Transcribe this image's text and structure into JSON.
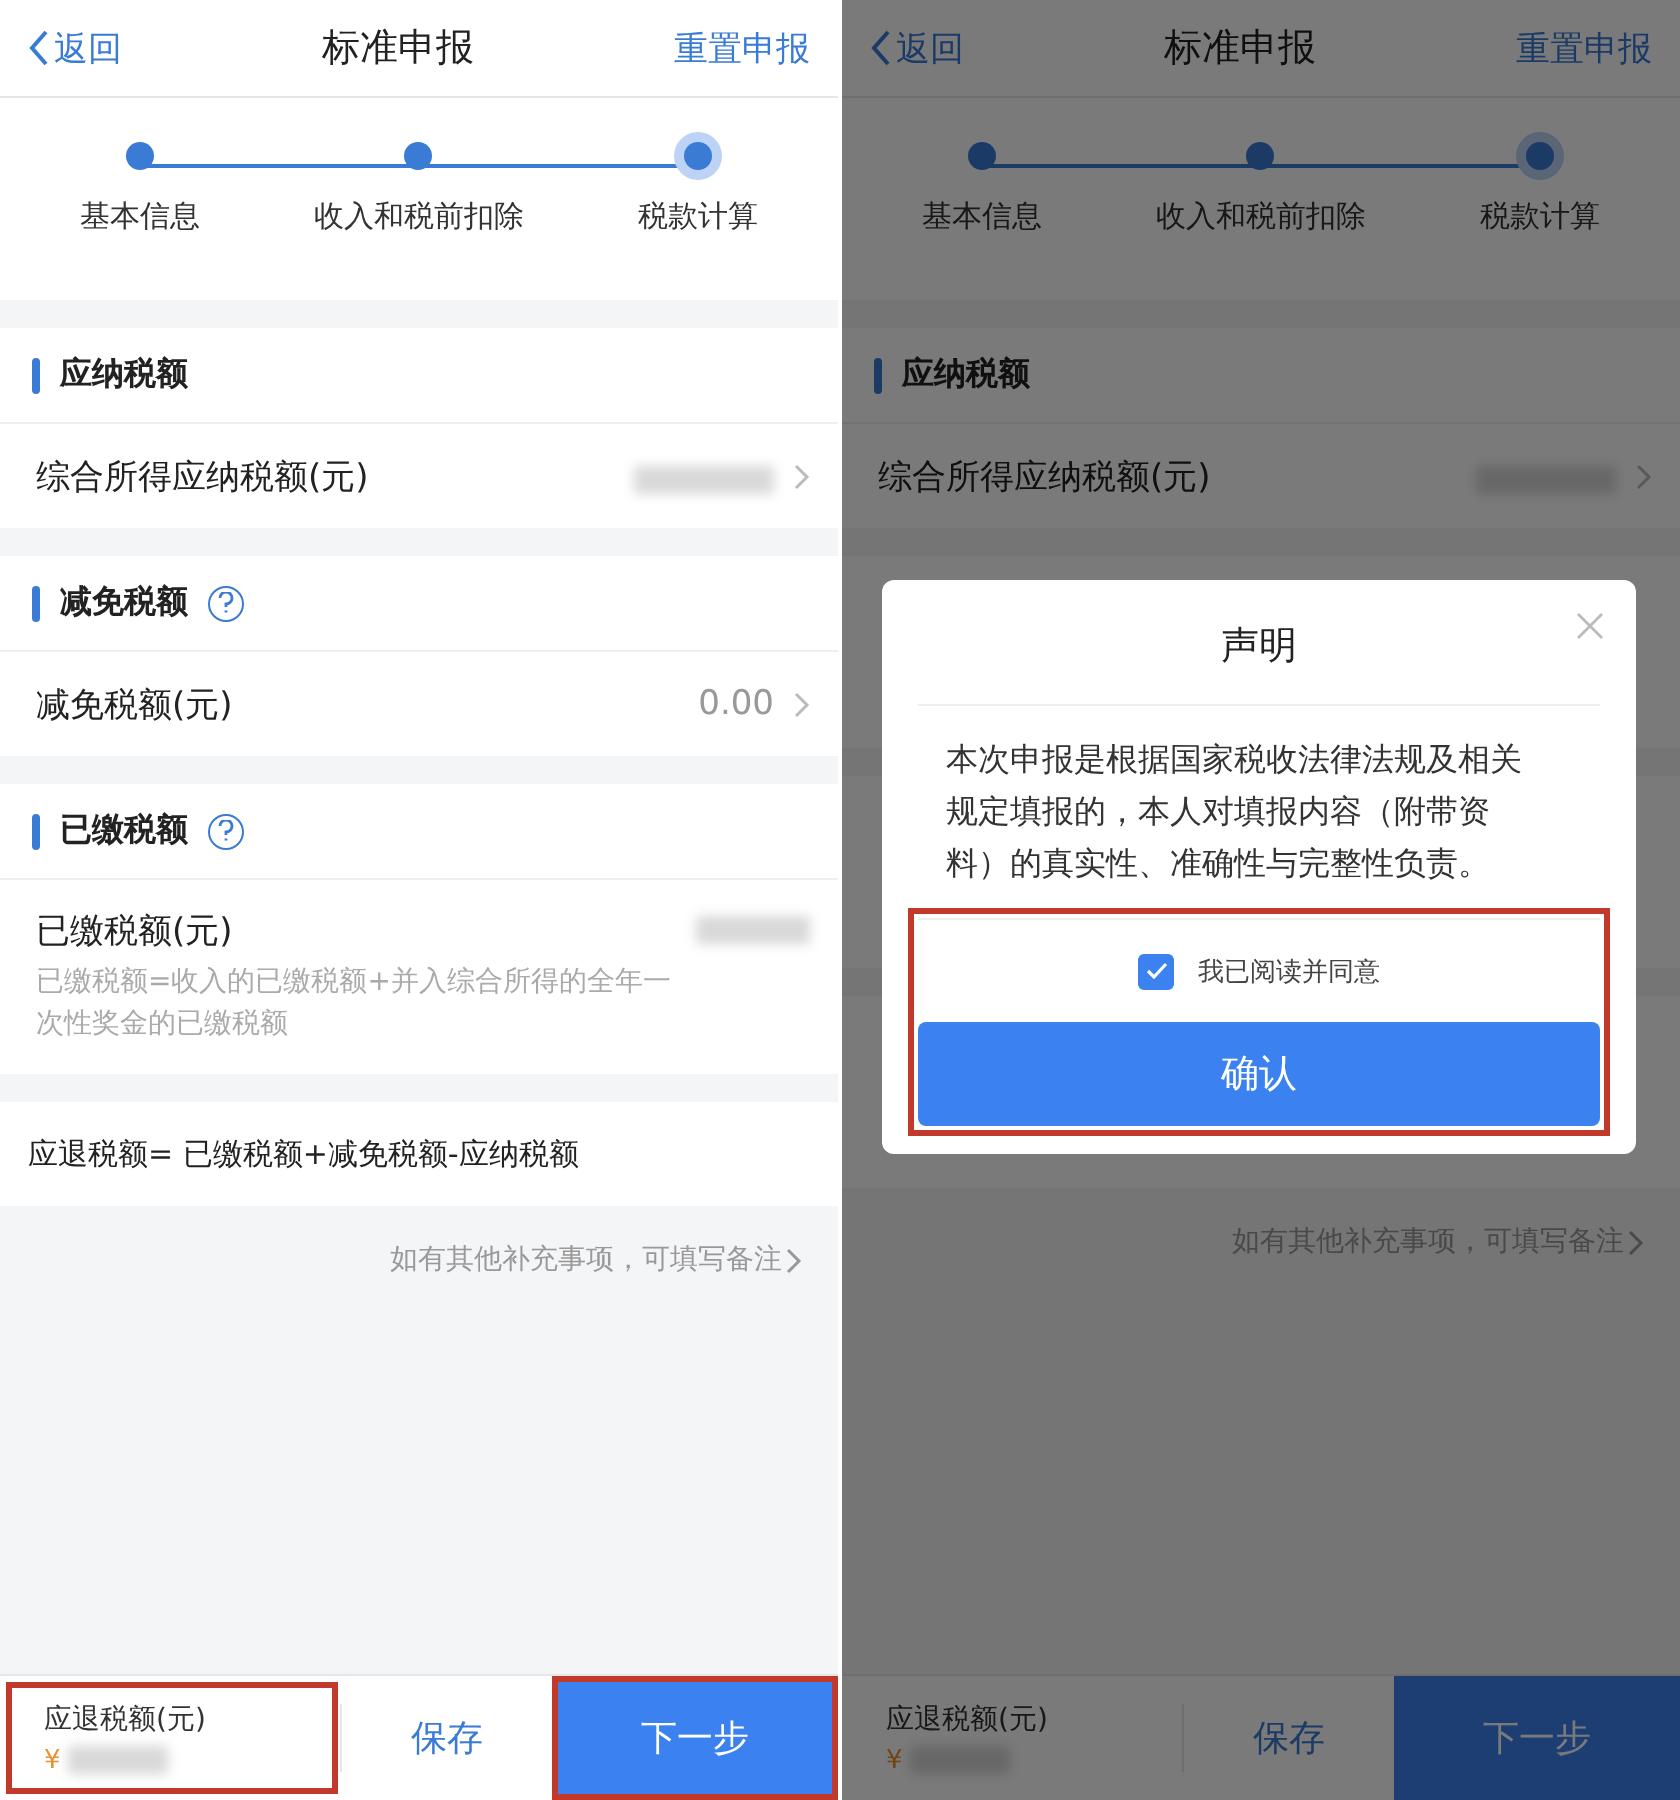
{
  "screens": [
    {
      "nav": {
        "back": "返回",
        "title": "标准申报",
        "action": "重置申报"
      },
      "steps": [
        {
          "label": "基本信息",
          "current": false
        },
        {
          "label": "收入和税前扣除",
          "current": false
        },
        {
          "label": "税款计算",
          "current": true
        }
      ],
      "sections": [
        {
          "title": "应纳税额",
          "help": false,
          "rows": [
            {
              "label": "综合所得应纳税额(元)",
              "value_blurred": true
            }
          ]
        },
        {
          "title": "减免税额",
          "help": true,
          "rows": [
            {
              "label": "减免税额(元)",
              "value": "0.00"
            }
          ]
        },
        {
          "title": "已缴税额",
          "help": true,
          "rows": [
            {
              "label": "已缴税额(元)",
              "note": "已缴税额=收入的已缴税额+并入综合所得的全年一次性奖金的已缴税额",
              "value_blurred": true
            }
          ]
        }
      ],
      "formula": "应退税额= 已缴税额+减免税额-应纳税额",
      "remark_link": "如有其他补充事项，可填写备注",
      "bottom": {
        "total_label": "应退税额(元)",
        "currency": "¥",
        "total_annotated": true,
        "save": "保存",
        "next": "下一步",
        "next_annotated": true
      }
    },
    {
      "nav": {
        "back": "返回",
        "title": "标准申报",
        "action": "重置申报"
      },
      "steps": [
        {
          "label": "基本信息",
          "current": false
        },
        {
          "label": "收入和税前扣除",
          "current": false
        },
        {
          "label": "税款计算",
          "current": true
        }
      ],
      "sections": [
        {
          "title": "应纳税额",
          "help": false,
          "rows": [
            {
              "label": "综合所得应纳税额(元)",
              "value_blurred": true
            }
          ]
        }
      ],
      "remark_link": "如有其他补充事项，可填写备注",
      "bottom": {
        "total_label": "应退税额(元)",
        "currency": "¥",
        "total_annotated": false,
        "save": "保存",
        "next": "下一步",
        "next_annotated": false
      },
      "dialog": {
        "title": "声明",
        "text": "本次申报是根据国家税收法律法规及相关规定填报的，本人对填报内容（附带资料）的真实性、准确性与完整性负责。",
        "agree_label": "我已阅读并同意",
        "agree_checked": true,
        "confirm": "确认",
        "annotated": true
      }
    }
  ]
}
